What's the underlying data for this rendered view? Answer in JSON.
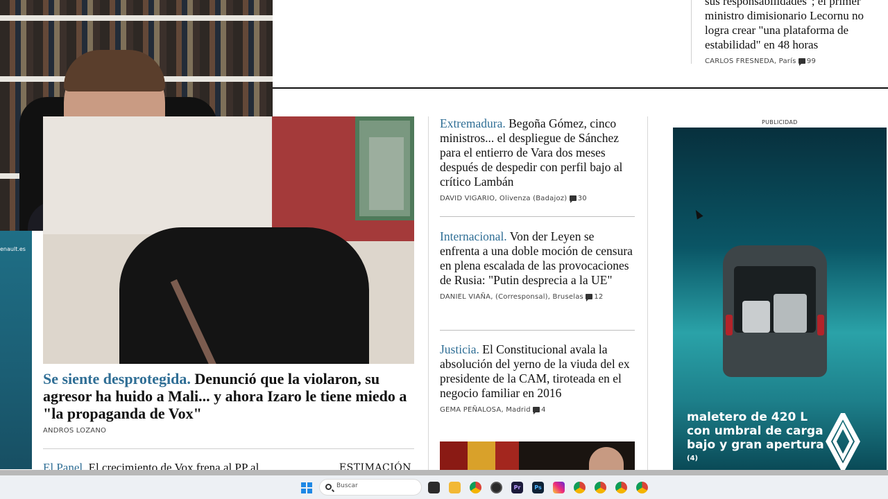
{
  "top_article": {
    "headline": "sus responsabilidades\"; el primer ministro dimisionario Lecornu no logra crear \"una plataforma de estabilidad\" en 48 horas",
    "author": "CARLOS FRESNEDA",
    "location": ", París",
    "comments": "99"
  },
  "left_ad": {
    "label": "enault.es"
  },
  "main_article": {
    "kicker": "Se siente desprotegida.",
    "headline": " Denunció que la violaron, su agresor ha huido a Mali... y ahora Izaro le tiene miedo a \"la propaganda de Vox\"",
    "author": "ANDROS LOZANO"
  },
  "panel_row": {
    "kicker": "El Panel.",
    "headline": " El crecimiento de Vox frena al PP al",
    "tag": "ESTIMACIÓN"
  },
  "stories": [
    {
      "kicker": "Extremadura.",
      "headline": " Begoña Gómez, cinco ministros... el despliegue de Sánchez para el entierro de Vara dos meses después de despedir con perfil bajo al crítico Lambán",
      "author": "DAVID VIGARIO",
      "location": ", Olivenza (Badajoz)",
      "comments": "30"
    },
    {
      "kicker": "Internacional.",
      "headline": " Von der Leyen se enfrenta a una doble moción de censura en plena escalada de las provocaciones de Rusia: \"Putin desprecia a la UE\"",
      "author": "DANIEL VIAÑA",
      "location": ", (Corresponsal), Bruselas",
      "comments": "12"
    },
    {
      "kicker": "Justicia.",
      "headline": " El Constitucional avala la absolución del yerno de la viuda del ex presidente de la CAM, tiroteada en el negocio familiar en 2016",
      "author": "GEMA PEÑALOSA",
      "location": ", Madrid",
      "comments": "4"
    }
  ],
  "ad": {
    "label": "PUBLICIDAD",
    "text": "maletero de 420 L con umbral de carga bajo y gran apertura",
    "footnote": "(4)"
  },
  "taskbar": {
    "search_placeholder": "Buscar",
    "apps": [
      "file-manager-icon",
      "folder-icon",
      "chrome-icon",
      "obs-icon",
      "premiere-icon",
      "photoshop-icon",
      "instagram-icon",
      "chrome-profile-1-icon",
      "chrome-profile-2-icon",
      "chrome-profile-3-icon",
      "chrome-profile-4-icon"
    ]
  },
  "colors": {
    "kicker": "#2f6e95",
    "ad_teal": "#2aa2a8",
    "taskbar": "#edf0f4"
  }
}
